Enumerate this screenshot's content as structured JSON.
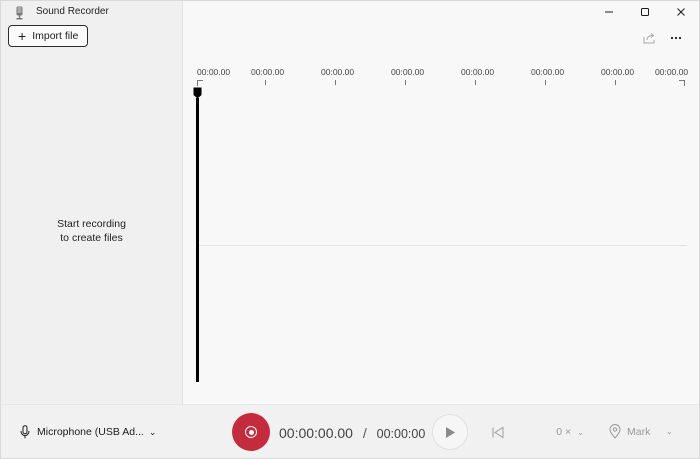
{
  "app": {
    "title": "Sound Recorder"
  },
  "sidebar": {
    "import_label": "Import file",
    "empty_line1": "Start recording",
    "empty_line2": "to create files"
  },
  "timeline": {
    "ticks": [
      "00:00.00",
      "00:00.00",
      "00:00.00",
      "00:00.00",
      "00:00.00",
      "00:00.00",
      "00:00.00",
      "00:00.00"
    ]
  },
  "controls": {
    "microphone_label": "Microphone (USB Ad...",
    "elapsed": "00:00:00.00",
    "separator": "/",
    "total": "00:00:00",
    "speed_label": "0 ×",
    "mark_label": "Mark"
  },
  "icons": {
    "app": "microphone-app-icon",
    "minimize": "minimize-icon",
    "maximize": "maximize-icon",
    "close": "close-icon",
    "share": "share-icon",
    "more": "more-icon",
    "microphone": "microphone-icon",
    "play": "play-icon",
    "skip_back": "skip-back-icon",
    "mark": "location-pin-icon"
  },
  "colors": {
    "record": "#c42b3c",
    "background": "#f3f3f3",
    "disabled_text": "#9a9a9a"
  }
}
